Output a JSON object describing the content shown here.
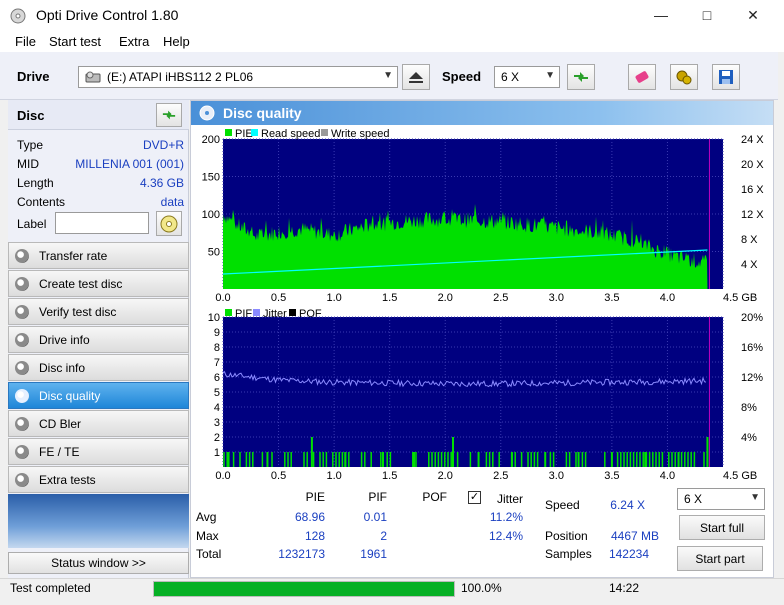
{
  "window": {
    "title": "Opti Drive Control 1.80"
  },
  "menu": [
    "File",
    "Start test",
    "Extra",
    "Help"
  ],
  "toolbar": {
    "drive_label": "Drive",
    "drive_value": "(E:)   ATAPI iHBS112   2 PL06",
    "speed_label": "Speed",
    "speed_value": "6 X"
  },
  "disc": {
    "header": "Disc",
    "type_key": "Type",
    "type_value": "DVD+R",
    "mid_key": "MID",
    "mid_value": "MILLENIA 001 (001)",
    "length_key": "Length",
    "length_value": "4.36 GB",
    "contents_key": "Contents",
    "contents_value": "data",
    "label_key": "Label",
    "label_value": ""
  },
  "nav": [
    {
      "label": "Transfer rate",
      "active": false
    },
    {
      "label": "Create test disc",
      "active": false
    },
    {
      "label": "Verify test disc",
      "active": false
    },
    {
      "label": "Drive info",
      "active": false
    },
    {
      "label": "Disc info",
      "active": false
    },
    {
      "label": "Disc quality",
      "active": true
    },
    {
      "label": "CD Bler",
      "active": false
    },
    {
      "label": "FE / TE",
      "active": false
    },
    {
      "label": "Extra tests",
      "active": false
    }
  ],
  "status_window_button": "Status window >>",
  "panel": {
    "title": "Disc quality"
  },
  "chart_data": [
    {
      "type": "area",
      "legend": [
        "PIE",
        "Read speed",
        "Write speed"
      ],
      "colors": {
        "PIE": "#00e000",
        "Read speed": "#00ffff",
        "Write speed": "#9a9a9a"
      },
      "x_ticks": [
        "0.0",
        "0.5",
        "1.0",
        "1.5",
        "2.0",
        "2.5",
        "3.0",
        "3.5",
        "4.0",
        "4.5 GB"
      ],
      "xlim": [
        0,
        4.5
      ],
      "y_ticks": [
        "50",
        "100",
        "150",
        "200"
      ],
      "ylim": [
        0,
        200
      ],
      "y2_ticks": [
        "4 X",
        "8 X",
        "12 X",
        "16 X",
        "20 X",
        "24 X"
      ],
      "y2lim": [
        0,
        24
      ],
      "series": [
        {
          "name": "PIE",
          "x": [
            0.0,
            0.1,
            0.3,
            0.5,
            0.7,
            1.0,
            1.3,
            1.6,
            1.9,
            2.2,
            2.5,
            2.8,
            3.1,
            3.4,
            3.7,
            3.9,
            4.1,
            4.36
          ],
          "y": [
            100,
            88,
            70,
            76,
            80,
            72,
            85,
            90,
            93,
            92,
            90,
            85,
            80,
            75,
            65,
            52,
            42,
            34
          ]
        },
        {
          "name": "Read speed",
          "x": [
            0.0,
            4.36
          ],
          "y": [
            2.4,
            6.24
          ]
        }
      ]
    },
    {
      "type": "line",
      "legend": [
        "PIF",
        "Jitter",
        "POF"
      ],
      "colors": {
        "PIF": "#00e000",
        "Jitter": "#8a8aff",
        "POF": "#000000"
      },
      "x_ticks": [
        "0.0",
        "0.5",
        "1.0",
        "1.5",
        "2.0",
        "2.5",
        "3.0",
        "3.5",
        "4.0",
        "4.5 GB"
      ],
      "xlim": [
        0,
        4.5
      ],
      "y_ticks": [
        "1",
        "2",
        "3",
        "4",
        "5",
        "6",
        "7",
        "8",
        "9",
        "10"
      ],
      "ylim": [
        0,
        10
      ],
      "y2_ticks": [
        "4%",
        "8%",
        "12%",
        "16%",
        "20%"
      ],
      "y2lim": [
        0,
        20
      ],
      "series": [
        {
          "name": "Jitter",
          "x": [
            0.0,
            0.5,
            1.0,
            1.5,
            2.0,
            2.5,
            3.0,
            3.5,
            4.0,
            4.36
          ],
          "y": [
            12.4,
            11.6,
            11.3,
            11.2,
            11.1,
            11.1,
            11.2,
            11.3,
            11.4,
            11.5
          ]
        },
        {
          "name": "PIF",
          "x": [
            0.05,
            0.4,
            0.8,
            1.1,
            1.44,
            1.72,
            2.07,
            2.3,
            2.6,
            2.9,
            3.2,
            3.5,
            3.8,
            4.1,
            4.36
          ],
          "y": [
            1,
            1,
            2,
            1,
            1,
            1,
            2,
            1,
            1,
            1,
            1,
            1,
            1,
            1,
            2
          ]
        }
      ]
    }
  ],
  "stats": {
    "col_pie": "PIE",
    "col_pif": "PIF",
    "col_pof": "POF",
    "col_jitter": "Jitter",
    "avg_label": "Avg",
    "avg_pie": "68.96",
    "avg_pif": "0.01",
    "avg_jitter": "11.2%",
    "max_label": "Max",
    "max_pie": "128",
    "max_pif": "2",
    "max_jitter": "12.4%",
    "total_label": "Total",
    "total_pie": "1232173",
    "total_pif": "1961",
    "jitter_checked": true,
    "speed_label": "Speed",
    "speed_value": "6.24 X",
    "position_label": "Position",
    "position_value": "4467 MB",
    "samples_label": "Samples",
    "samples_value": "142234",
    "speed_select": "6 X",
    "start_full": "Start full",
    "start_part": "Start part"
  },
  "status": {
    "text": "Test completed",
    "progress": 1.0,
    "progress_text": "100.0%",
    "time": "14:22"
  }
}
